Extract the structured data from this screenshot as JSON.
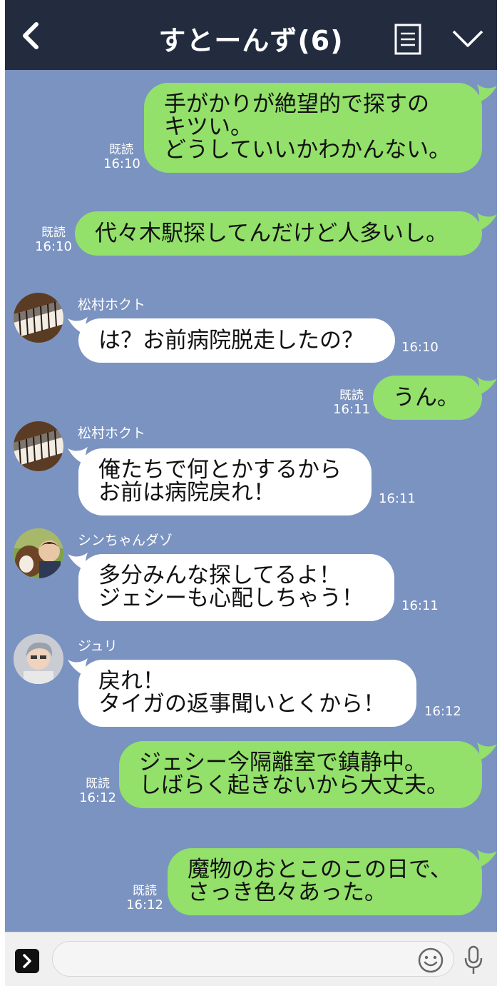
{
  "header": {
    "title": "すとーんず(6)",
    "icons": [
      "back-chevron-icon",
      "menu-list-icon",
      "chevron-down-icon"
    ]
  },
  "colors": {
    "header_bg": "#232c3f",
    "chat_bg": "#7b93c1",
    "sent_bubble": "#93e06a",
    "received_bubble": "#ffffff"
  },
  "messages": [
    {
      "direction": "sent",
      "lines": [
        "手がかりが絶望的で探すの",
        "キツい。",
        "どうしていいかわかんない。"
      ],
      "read_label": "既読",
      "time": "16:10"
    },
    {
      "direction": "sent",
      "lines": [
        "代々木駅探してんだけど人多いし。"
      ],
      "read_label": "既読",
      "time": "16:10"
    },
    {
      "direction": "received",
      "sender": "松村ホクト",
      "avatar": "piano-keys-avatar",
      "lines": [
        "は？お前病院脱走したの？"
      ],
      "time": "16:10"
    },
    {
      "direction": "sent",
      "lines": [
        "うん。"
      ],
      "read_label": "既読",
      "time": "16:11"
    },
    {
      "direction": "received",
      "sender": "松村ホクト",
      "avatar": "piano-keys-avatar",
      "lines": [
        "俺たちで何とかするから",
        "お前は病院戻れ！"
      ],
      "time": "16:11"
    },
    {
      "direction": "received",
      "sender": "シンちゃんダゾ",
      "avatar": "dog-photo-avatar",
      "lines": [
        "多分みんな探してるよ！",
        "ジェシーも心配しちゃう！"
      ],
      "time": "16:11"
    },
    {
      "direction": "received",
      "sender": "ジュリ",
      "avatar": "person-photo-avatar",
      "lines": [
        "戻れ！",
        "タイガの返事聞いとくから！"
      ],
      "time": "16:12"
    },
    {
      "direction": "sent",
      "lines": [
        "ジェシー今隔離室で鎮静中。",
        "しばらく起きないから大丈夫。"
      ],
      "read_label": "既読",
      "time": "16:12"
    },
    {
      "direction": "sent",
      "lines": [
        "魔物のおとこのこの日で、",
        "さっき色々あった。"
      ],
      "read_label": "既読",
      "time": "16:12"
    }
  ],
  "input": {
    "placeholder": "",
    "icons": [
      "expand-arrow-icon",
      "emoji-icon",
      "microphone-icon"
    ]
  }
}
